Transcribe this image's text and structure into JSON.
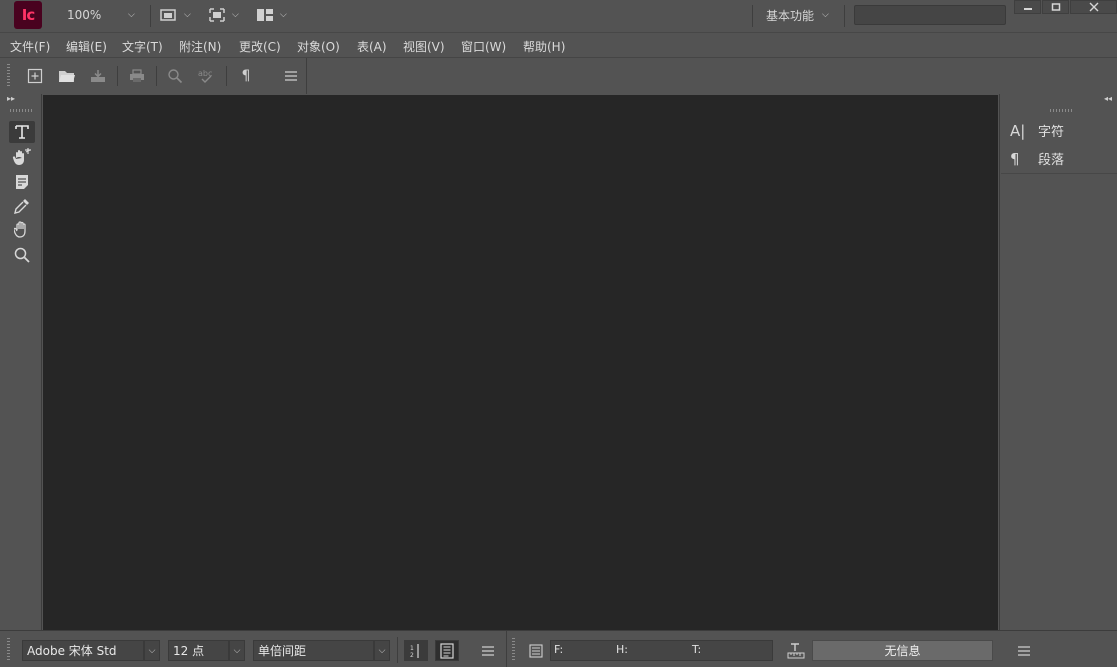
{
  "app": {
    "logo_text": "Ic",
    "brand_color": "#49021f",
    "logo_color": "#ff3366"
  },
  "titlebar": {
    "zoom": "100%",
    "workspace": "基本功能",
    "search_placeholder": ""
  },
  "menu": {
    "items": [
      "文件(F)",
      "编辑(E)",
      "文字(T)",
      "附注(N)",
      "更改(C)",
      "对象(O)",
      "表(A)",
      "视图(V)",
      "窗口(W)",
      "帮助(H)"
    ]
  },
  "toolbar": {
    "icons": [
      "new-document-icon",
      "open-icon",
      "save-icon",
      "print-icon",
      "find-icon",
      "spellcheck-icon",
      "pilcrow-icon",
      "panel-menu-icon"
    ]
  },
  "tools": [
    "type-tool",
    "position-tool",
    "note-tool",
    "eyedropper-tool",
    "hand-tool",
    "zoom-tool"
  ],
  "right_panel": {
    "items": [
      {
        "icon": "A|",
        "label": "字符"
      },
      {
        "icon": "¶",
        "label": "段落"
      }
    ]
  },
  "statusbar": {
    "font": "Adobe 宋体 Std",
    "size": "12 点",
    "spacing": "单倍间距",
    "f_label": "F:",
    "h_label": "H:",
    "t_label": "T:",
    "info": "无信息"
  },
  "colors": {
    "chrome": "#535353",
    "canvas": "#262626"
  }
}
